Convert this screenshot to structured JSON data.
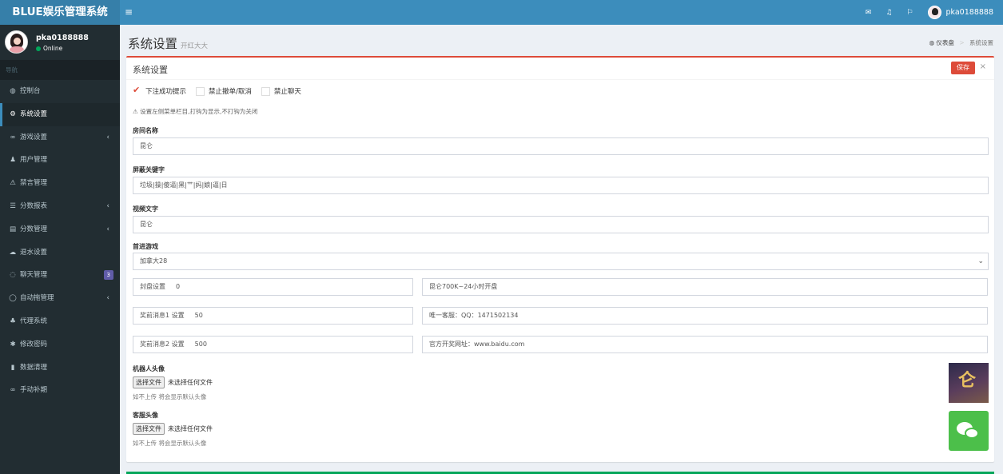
{
  "header": {
    "logo": "BLUE娱乐管理系统",
    "toggle_icon": "menu-toggle-icon",
    "icons": [
      "envelope-icon",
      "bell-icon",
      "flag-icon"
    ],
    "username": "pka0188888"
  },
  "sidebar": {
    "user": {
      "name": "pka0188888",
      "status": "Online"
    },
    "nav_header": "导航",
    "items": [
      {
        "label": "控制台",
        "icon": "dashboard-icon",
        "glyph": "◍",
        "active": false,
        "caret": false
      },
      {
        "label": "系统设置",
        "icon": "cogs-icon",
        "glyph": "⚙",
        "active": true,
        "caret": false
      },
      {
        "label": "游戏设置",
        "icon": "gamepad-icon",
        "glyph": "∞",
        "active": false,
        "caret": true
      },
      {
        "label": "用户管理",
        "icon": "users-icon",
        "glyph": "♟",
        "active": false,
        "caret": false
      },
      {
        "label": "禁言管理",
        "icon": "warning-icon",
        "glyph": "⚠",
        "active": false,
        "caret": false
      },
      {
        "label": "分数报表",
        "icon": "list-icon",
        "glyph": "☰",
        "active": false,
        "caret": true
      },
      {
        "label": "分数管理",
        "icon": "database-icon",
        "glyph": "▤",
        "active": false,
        "caret": true
      },
      {
        "label": "退水设置",
        "icon": "cloud-icon",
        "glyph": "☁",
        "active": false,
        "caret": false
      },
      {
        "label": "聊天管理",
        "icon": "chat-icon",
        "glyph": "◌",
        "active": false,
        "caret": false,
        "badge": "3"
      },
      {
        "label": "自动拖管理",
        "icon": "comment-icon",
        "glyph": "◯",
        "active": false,
        "caret": true
      },
      {
        "label": "代理系统",
        "icon": "user-plus-icon",
        "glyph": "♣",
        "active": false,
        "caret": false
      },
      {
        "label": "修改密码",
        "icon": "gear-icon",
        "glyph": "✱",
        "active": false,
        "caret": false
      },
      {
        "label": "数据清理",
        "icon": "trash-icon",
        "glyph": "▮",
        "active": false,
        "caret": false
      },
      {
        "label": "手动补期",
        "icon": "link-icon",
        "glyph": "∞",
        "active": false,
        "caret": false
      }
    ]
  },
  "content": {
    "title": "系统设置",
    "subtitle": "开红大大",
    "breadcrumb": {
      "home": "仪表盘",
      "current": "系统设置"
    }
  },
  "box": {
    "title": "系统设置",
    "save_label": "保存",
    "close_label": "×",
    "checkboxes": [
      {
        "label": "下注成功提示",
        "checked": true
      },
      {
        "label": "禁止撤单/取消",
        "checked": false
      },
      {
        "label": "禁止聊天",
        "checked": false
      }
    ],
    "hint": "设置左侧菜单栏目,打钩为显示,不打钩为关闭",
    "room_name_label": "房间名称",
    "room_name": "昆仑",
    "keywords_label": "屏蔽关键字",
    "keywords": "垃圾|操|傻逼|黑|艹|妈|娘|逼|日",
    "video_label": "视频文字",
    "video_text": "昆仑",
    "game_label": "首进游戏",
    "game_value": "加拿大28",
    "seal_label": "封盘设置",
    "seal_value": "0",
    "seal_right": "昆仑700K~24小时开盘",
    "msg1_label": "奖前消息1 设置",
    "msg1_value": "50",
    "msg1_right": "唯一客服：QQ：1471502134",
    "msg2_label": "奖前消息2 设置",
    "msg2_value": "500",
    "msg2_right": "官方开奖网址：www.baidu.com",
    "robot_label": "机器人头像",
    "robot_btn": "选择文件",
    "robot_file": "未选择任何文件",
    "robot_help": "如不上传 将会显示默认头像",
    "service_label": "客服头像",
    "service_btn": "选择文件",
    "service_file": "未选择任何文件",
    "service_help": "如不上传 将会显示默认头像"
  },
  "colors": {
    "header": "#3c8dbc",
    "logo_bg": "#367fa9",
    "sidebar": "#222d32",
    "danger": "#dd4b39",
    "success": "#00a65a",
    "badge": "#605ca8"
  }
}
